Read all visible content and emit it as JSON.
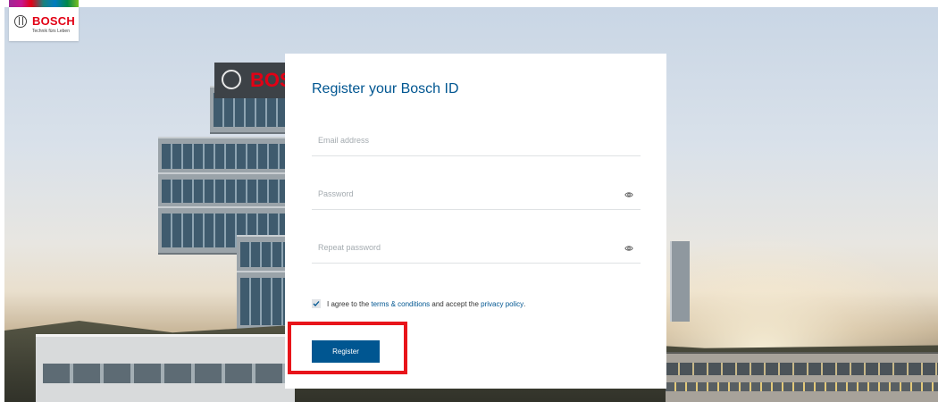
{
  "brand": {
    "name": "BOSCH",
    "tagline": "Technik fürs Leben",
    "colors": {
      "red": "#e20015",
      "blue": "#005691"
    }
  },
  "background_sign": {
    "text": "BOSCH"
  },
  "form": {
    "title": "Register your Bosch ID",
    "email": {
      "placeholder": "Email address",
      "value": ""
    },
    "password": {
      "placeholder": "Password",
      "value": "",
      "icon": "eye-icon"
    },
    "repeat_password": {
      "placeholder": "Repeat password",
      "value": "",
      "icon": "eye-icon"
    },
    "agree": {
      "checked": true,
      "text_before": "I agree to the ",
      "terms_link": "terms & conditions",
      "text_middle": " and accept the ",
      "privacy_link": "privacy policy",
      "text_after": "."
    },
    "register_label": "Register"
  },
  "annotation": {
    "highlight_color": "#e8141a",
    "target": "Register"
  }
}
